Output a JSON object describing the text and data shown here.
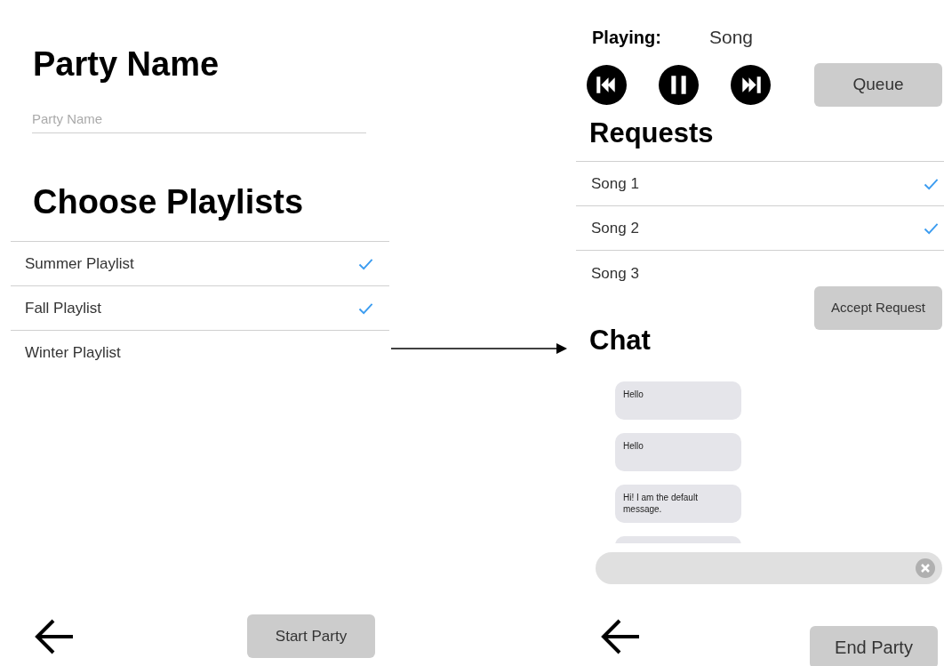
{
  "setup_screen": {
    "title": "Party Name",
    "name_field": {
      "placeholder": "Party Name"
    },
    "playlists_title": "Choose Playlists",
    "playlists": [
      {
        "label": "Summer Playlist",
        "checked": true
      },
      {
        "label": "Fall Playlist",
        "checked": true
      },
      {
        "label": "Winter Playlist",
        "checked": false
      }
    ],
    "start_button": "Start Party"
  },
  "party_screen": {
    "playing_label": "Playing:",
    "playing_song": "Song",
    "queue_button": "Queue",
    "requests_title": "Requests",
    "requests": [
      {
        "label": "Song 1",
        "checked": true
      },
      {
        "label": "Song 2",
        "checked": true
      },
      {
        "label": "Song 3",
        "checked": false
      }
    ],
    "accept_button": "Accept Request",
    "chat_title": "Chat",
    "messages": [
      "Hello",
      "Hello",
      "Hi! I am the default message."
    ],
    "end_button": "End Party"
  }
}
